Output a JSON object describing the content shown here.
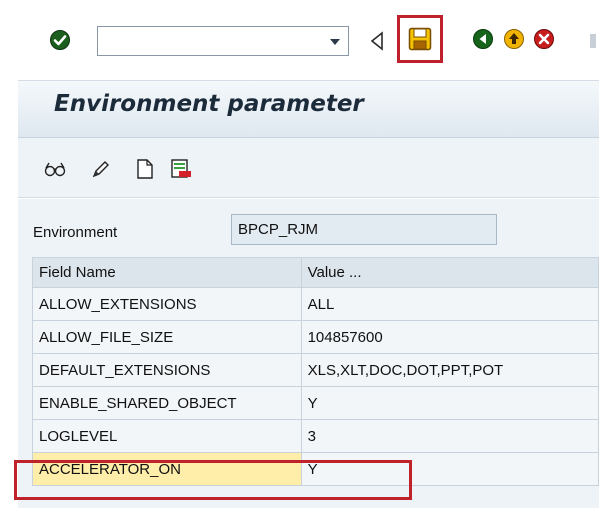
{
  "toolbar": {
    "command_field_value": "",
    "buttons": [
      "enter-icon",
      "back-nav-icon",
      "save-icon",
      "back-icon",
      "exit-icon",
      "cancel-icon"
    ]
  },
  "title": "Environment parameter",
  "app_toolbar": {
    "buttons": [
      "display-change-icon",
      "pencil-icon",
      "new-document-icon",
      "delete-icon"
    ]
  },
  "environment": {
    "label": "Environment",
    "value": "BPCP_RJM"
  },
  "table": {
    "headers": [
      "Field Name",
      "Value ..."
    ],
    "rows": [
      [
        "ALLOW_EXTENSIONS",
        "ALL"
      ],
      [
        "ALLOW_FILE_SIZE",
        "104857600"
      ],
      [
        "DEFAULT_EXTENSIONS",
        "XLS,XLT,DOC,DOT,PPT,POT"
      ],
      [
        "ENABLE_SHARED_OBJECT",
        "Y"
      ],
      [
        "LOGLEVEL",
        "3"
      ],
      [
        "ACCELERATOR_ON",
        "Y"
      ]
    ]
  },
  "colors": {
    "highlight_border": "#c0222c",
    "highlight_cell": "#ffeeaa"
  }
}
